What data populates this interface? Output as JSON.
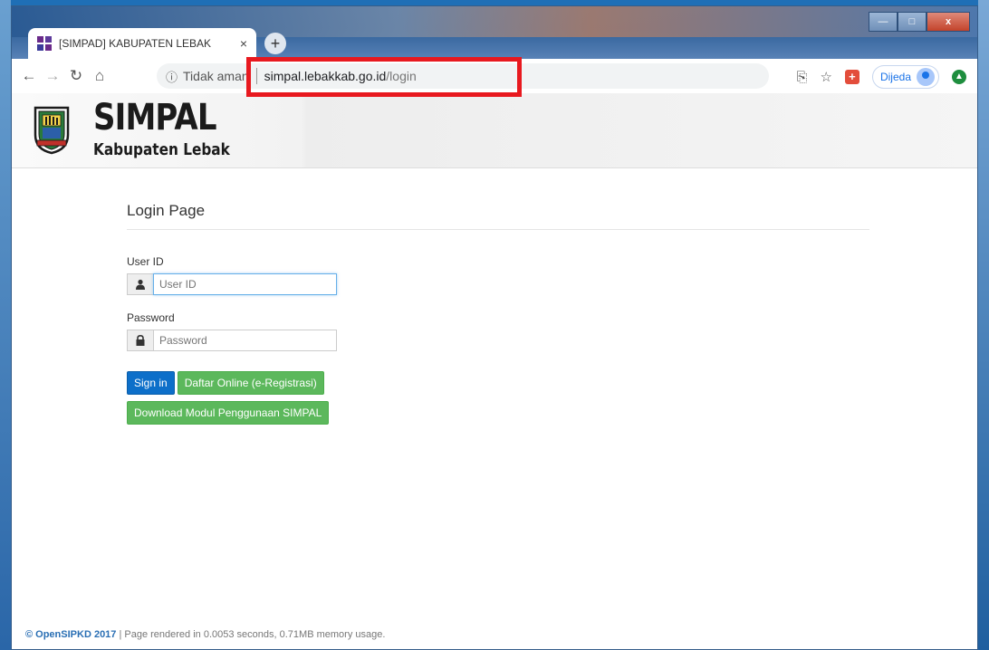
{
  "browser": {
    "tab_title": "[SIMPAD] KABUPATEN LEBAK",
    "tab_close": "×",
    "new_tab": "+",
    "security_text": "Tidak aman",
    "url_host": "simpal.lebakkab.go.id",
    "url_path": "/login",
    "profile_name": "Dijeda",
    "window_controls": {
      "minimize": "—",
      "maximize": "□",
      "close": "x"
    }
  },
  "header": {
    "logo_title": "SIMPAL",
    "logo_subtitle": "Kabupaten Lebak"
  },
  "login": {
    "page_title": "Login Page",
    "userid_label": "User ID",
    "userid_placeholder": "User ID",
    "password_label": "Password",
    "password_placeholder": "Password",
    "signin_label": "Sign in",
    "register_label": "Daftar Online (e-Registrasi)",
    "download_label": "Download Modul Penggunaan SIMPAL"
  },
  "footer": {
    "copyright_link": "© OpenSIPKD 2017",
    "rendered_text": " | Page rendered in 0.0053 seconds, 0.71MB memory usage."
  },
  "colors": {
    "primary_button": "#0d6fc9",
    "success_button": "#5cb85c",
    "highlight_box": "#e8191f"
  }
}
